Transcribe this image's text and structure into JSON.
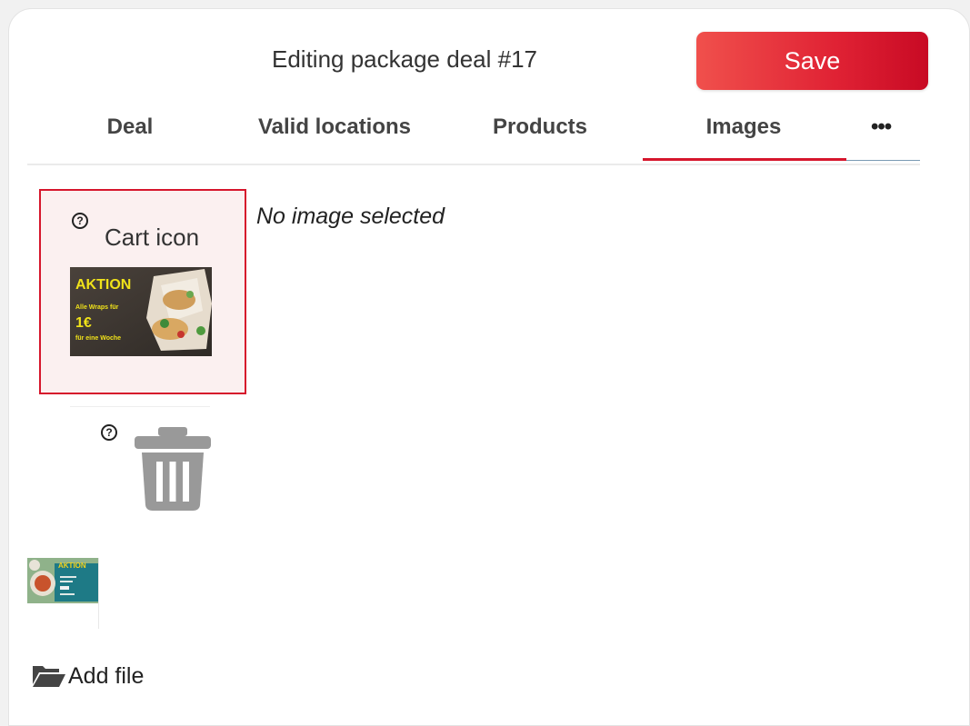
{
  "header": {
    "title": "Editing package deal #17",
    "save_label": "Save"
  },
  "tabs": [
    {
      "label": "Deal"
    },
    {
      "label": "Valid locations"
    },
    {
      "label": "Products"
    },
    {
      "label": "Images",
      "active": true
    },
    {
      "label": "•••"
    }
  ],
  "images": {
    "selected_card": {
      "help": "?",
      "label": "Cart icon",
      "thumbnail": {
        "headline": "AKTION",
        "line1": "Alle Wraps für",
        "price": "1€",
        "line2": "für eine Woche"
      }
    },
    "second_slot": {
      "help": "?",
      "thumbnail": {
        "headline": "AKTION"
      }
    },
    "preview_message": "No image selected",
    "add_file_label": "Add file"
  },
  "colors": {
    "accent": "#d6162c",
    "save_gradient_start": "#f0504c",
    "save_gradient_end": "#c80a24",
    "selected_card_bg": "#fbf0f0",
    "trash_gray": "#999999"
  }
}
